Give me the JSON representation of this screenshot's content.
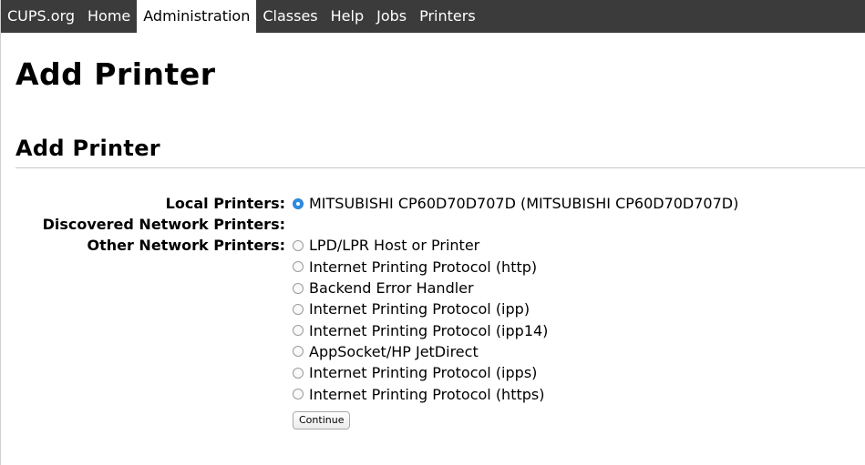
{
  "nav": {
    "items": [
      {
        "label": "CUPS.org",
        "active": false
      },
      {
        "label": "Home",
        "active": false
      },
      {
        "label": "Administration",
        "active": true
      },
      {
        "label": "Classes",
        "active": false
      },
      {
        "label": "Help",
        "active": false
      },
      {
        "label": "Jobs",
        "active": false
      },
      {
        "label": "Printers",
        "active": false
      }
    ]
  },
  "page_title": "Add Printer",
  "section_title": "Add Printer",
  "form": {
    "local_label": "Local Printers:",
    "local_options": [
      {
        "label": "MITSUBISHI CP60D70D707D (MITSUBISHI CP60D70D707D)",
        "selected": true
      }
    ],
    "discovered_label": "Discovered Network Printers:",
    "other_label": "Other Network Printers:",
    "other_options": [
      {
        "label": "LPD/LPR Host or Printer",
        "selected": false
      },
      {
        "label": "Internet Printing Protocol (http)",
        "selected": false
      },
      {
        "label": "Backend Error Handler",
        "selected": false
      },
      {
        "label": "Internet Printing Protocol (ipp)",
        "selected": false
      },
      {
        "label": "Internet Printing Protocol (ipp14)",
        "selected": false
      },
      {
        "label": "AppSocket/HP JetDirect",
        "selected": false
      },
      {
        "label": "Internet Printing Protocol (ipps)",
        "selected": false
      },
      {
        "label": "Internet Printing Protocol (https)",
        "selected": false
      }
    ],
    "continue_label": "Continue"
  },
  "colors": {
    "navbar_bg": "#3b3b3b",
    "radio_selected": "#2f8de4"
  }
}
